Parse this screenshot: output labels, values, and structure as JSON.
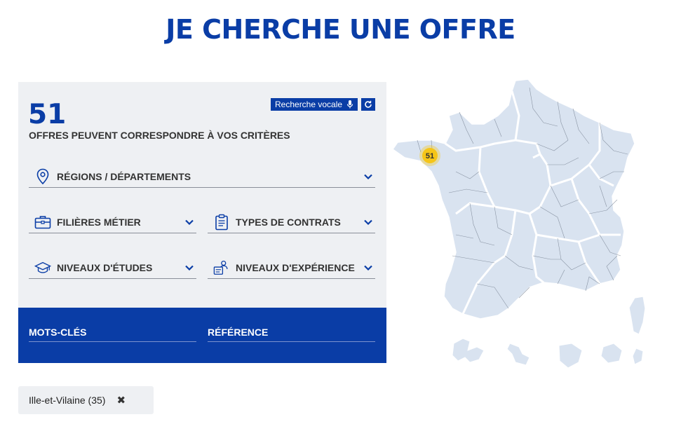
{
  "page": {
    "title": "JE CHERCHE UNE OFFRE"
  },
  "results": {
    "count": "51",
    "text": "OFFRES PEUVENT CORRESPONDRE À VOS CRITÈRES"
  },
  "toolbar": {
    "voice_label": "Recherche vocale",
    "voice_icon": "microphone-icon",
    "reset_icon": "refresh-icon"
  },
  "filters": {
    "regions": {
      "label": "RÉGIONS / DÉPARTEMENTS",
      "icon": "location-pin-icon"
    },
    "filieres": {
      "label": "FILIÈRES MÉTIER",
      "icon": "briefcase-icon"
    },
    "contrats": {
      "label": "TYPES DE CONTRATS",
      "icon": "clipboard-icon"
    },
    "etudes": {
      "label": "NIVEAUX D'ÉTUDES",
      "icon": "graduation-cap-icon"
    },
    "experience": {
      "label": "NIVEAUX D'EXPÉRIENCE",
      "icon": "user-cv-icon"
    }
  },
  "search": {
    "keywords_label": "MOTS-CLÉS",
    "reference_label": "RÉFÉRENCE"
  },
  "active_tags": [
    {
      "label": "Ille-et-Vilaine (35)",
      "remove_glyph": "✖"
    }
  ],
  "map": {
    "marker_count": "51",
    "land_color": "#d9e3f0",
    "marker_color": "#f5c518"
  },
  "colors": {
    "brand": "#0a3da6",
    "panel": "#eef0f3"
  }
}
